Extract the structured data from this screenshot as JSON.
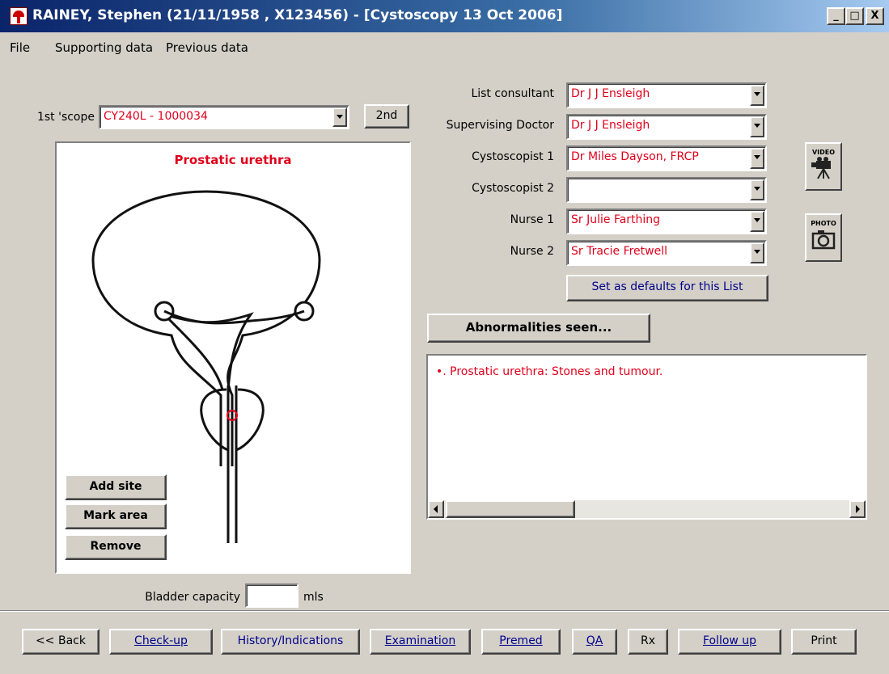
{
  "window": {
    "title": "RAINEY, Stephen (21/11/1958 , X123456) - [Cystoscopy 13 Oct 2006]",
    "minimize": "_",
    "maximize": "□",
    "close": "X"
  },
  "menu": [
    "File",
    "Supporting data",
    "Previous data"
  ],
  "scope": {
    "label": "1st 'scope",
    "value": "CY240L - 1000034",
    "second_button": "2nd"
  },
  "diagram": {
    "title": "Prostatic urethra",
    "buttons": {
      "add_site": "Add site",
      "mark_area": "Mark area",
      "remove": "Remove"
    }
  },
  "bladder": {
    "label": "Bladder capacity",
    "value": "",
    "unit": "mls"
  },
  "staff": [
    {
      "label": "List consultant",
      "value": "Dr J J Ensleigh"
    },
    {
      "label": "Supervising Doctor",
      "value": "Dr J J Ensleigh"
    },
    {
      "label": "Cystoscopist 1",
      "value": "Dr Miles Dayson, FRCP"
    },
    {
      "label": "Cystoscopist 2",
      "value": ""
    },
    {
      "label": "Nurse 1",
      "value": "Sr Julie Farthing"
    },
    {
      "label": "Nurse 2",
      "value": "Sr Tracie Fretwell"
    }
  ],
  "set_defaults_button": "Set as defaults for this List",
  "media": {
    "video": "VIDEO",
    "photo": "PHOTO"
  },
  "abnormalities": {
    "button": "Abnormalities seen...",
    "items": [
      "•. Prostatic urethra: Stones and tumour."
    ]
  },
  "nav": {
    "back": "<< Back",
    "checkup": "Check-up",
    "history": "History/Indications",
    "examination": "Examination",
    "premed": "Premed",
    "qa": "QA",
    "rx": "Rx",
    "followup": "Follow up",
    "print": "Print"
  },
  "colors": {
    "field_text": "#e0001b",
    "link_text": "#00008b",
    "background": "#d4d0c8"
  }
}
